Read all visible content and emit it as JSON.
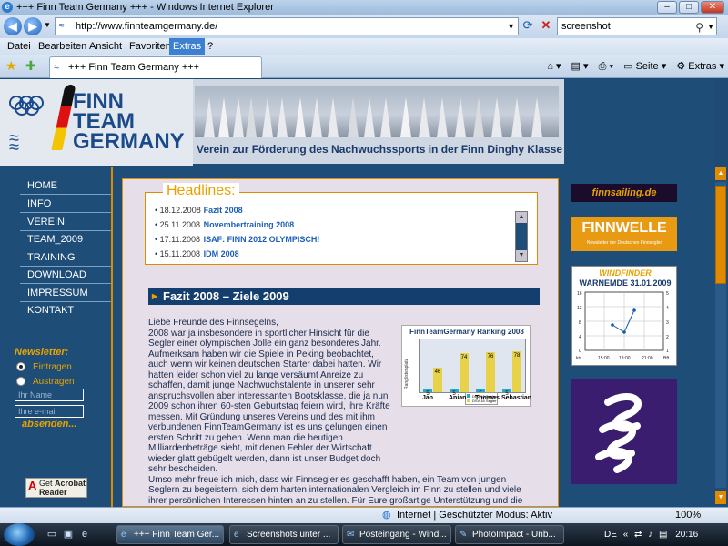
{
  "window": {
    "title": "+++ Finn Team Germany +++ - Windows Internet Explorer",
    "minimize": "–",
    "maximize": "□",
    "close": "✕"
  },
  "address": {
    "url": "http://www.finnteamgermany.de/",
    "search_value": "screenshot"
  },
  "menu": [
    "Datei",
    "Bearbeiten",
    "Ansicht",
    "Favoriten",
    "Extras",
    "?"
  ],
  "menu_selected": "Extras",
  "tab": {
    "label": "+++ Finn Team Germany +++"
  },
  "commandbar": {
    "page": "Seite",
    "tools": "Extras"
  },
  "site": {
    "logo_lines": [
      "FINN",
      "TEAM",
      "GERMANY"
    ],
    "tagline": "Verein zur Förderung des Nachwuchssports in der Finn Dinghy Klasse e.V.",
    "nav": [
      "HOME",
      "INFO",
      "VEREIN",
      "TEAM_2009",
      "TRAINING",
      "DOWNLOAD",
      "IMPRESSUM",
      "KONTAKT"
    ],
    "newsletter": {
      "label": "Newsletter:",
      "options": [
        "Eintragen",
        "Austragen"
      ],
      "selected": "Eintragen",
      "name_placeholder": "Ihr Name",
      "email_placeholder": "Ihre e-mail",
      "submit": "absenden..."
    },
    "acrobat": {
      "get": "Get",
      "product": "Acrobat Reader",
      "brand": "Adobe"
    },
    "headlines": {
      "title": "Headlines:",
      "items": [
        {
          "date": "18.12.2008",
          "title": "Fazit 2008"
        },
        {
          "date": "25.11.2008",
          "title": "Novembertraining 2008"
        },
        {
          "date": "17.11.2008",
          "title": "ISAF: FINN 2012 OLYMPISCH!"
        },
        {
          "date": "15.11.2008",
          "title": "IDM 2008"
        }
      ]
    },
    "article": {
      "title": "Fazit 2008 – Ziele 2009",
      "greeting": "Liebe Freunde des Finnsegelns,",
      "p1": "2008 war ja insbesondere in sportlicher Hinsicht für die Segler einer olympischen Jolle ein ganz besonderes Jahr.",
      "p2": "Aufmerksam haben wir die Spiele in Peking beobachtet, auch wenn wir keinen deutschen Starter dabei hatten. Wir hatten leider schon viel zu lange versäumt Anreize zu schaffen, damit junge Nachwuchstalente in unserer sehr anspruchsvollen aber interessanten Bootsklasse, die ja nun 2009 schon ihren 60-sten Geburtstag feiern wird, ihre Kräfte messen. Mit Gründung unseres Vereins und des mit ihm verbundenen FinnTeamGermany ist es uns gelungen einen ersten Schritt zu gehen. Wenn man die heutigen Milliardenbeträge sieht, mit denen Fehler der Wirtschaft wieder glatt gebügelt werden, dann ist unser Budget doch sehr bescheiden.",
      "p3": "Umso mehr freue ich mich, dass wir Finnsegler es geschafft haben, ein Team von jungen Seglern zu begeistern, sich dem harten internationalen Vergleich im Finn zu stellen und viele ihrer persönlichen Interessen hinten an zu stellen. Für Eure großartige Unterstützung und die vielen"
    },
    "right": {
      "finnsailing": "finnsailing.de",
      "finnwelle": "FINNWELLE",
      "finnwelle_sub": "Newsletter der Deutschen Finnsegler",
      "windfinder": "WINDFINDER",
      "windfinder_date": "WARNEMDE 31.01.2009",
      "wf_times": [
        "15:00",
        "18:00",
        "21:00"
      ],
      "wf_left_ticks": [
        "16",
        "12",
        "8",
        "4",
        "0"
      ],
      "wf_right_ticks": [
        "5",
        "4",
        "3",
        "2",
        "1"
      ],
      "wf_units": [
        "kts",
        "Bft"
      ]
    }
  },
  "chart_data": {
    "type": "bar",
    "title": "FinnTeamGermany Ranking 2008",
    "ylabel": "Ranglistenplatz",
    "categories": [
      "Jan",
      "Anian",
      "Thomas",
      "Sebastian"
    ],
    "series": [
      {
        "name": "DFV 10-Segler",
        "values": [
          5,
          5,
          5,
          5
        ],
        "color": "#2aa7c8"
      },
      {
        "name": "DSV 16 Segler",
        "values": [
          46,
          74,
          76,
          78
        ],
        "color": "#e8d24a"
      }
    ],
    "ylim": [
      0,
      100
    ],
    "grid": true,
    "legend": "bottom"
  },
  "status": {
    "zone": "Internet | Geschützter Modus: Aktiv",
    "zoom": "100%"
  },
  "taskbar": {
    "items": [
      "+++ Finn Team Ger...",
      "Screenshots unter ...",
      "Posteingang - Wind...",
      "PhotoImpact - Unb..."
    ],
    "active": 0,
    "lang": "DE",
    "clock": "20:16"
  }
}
